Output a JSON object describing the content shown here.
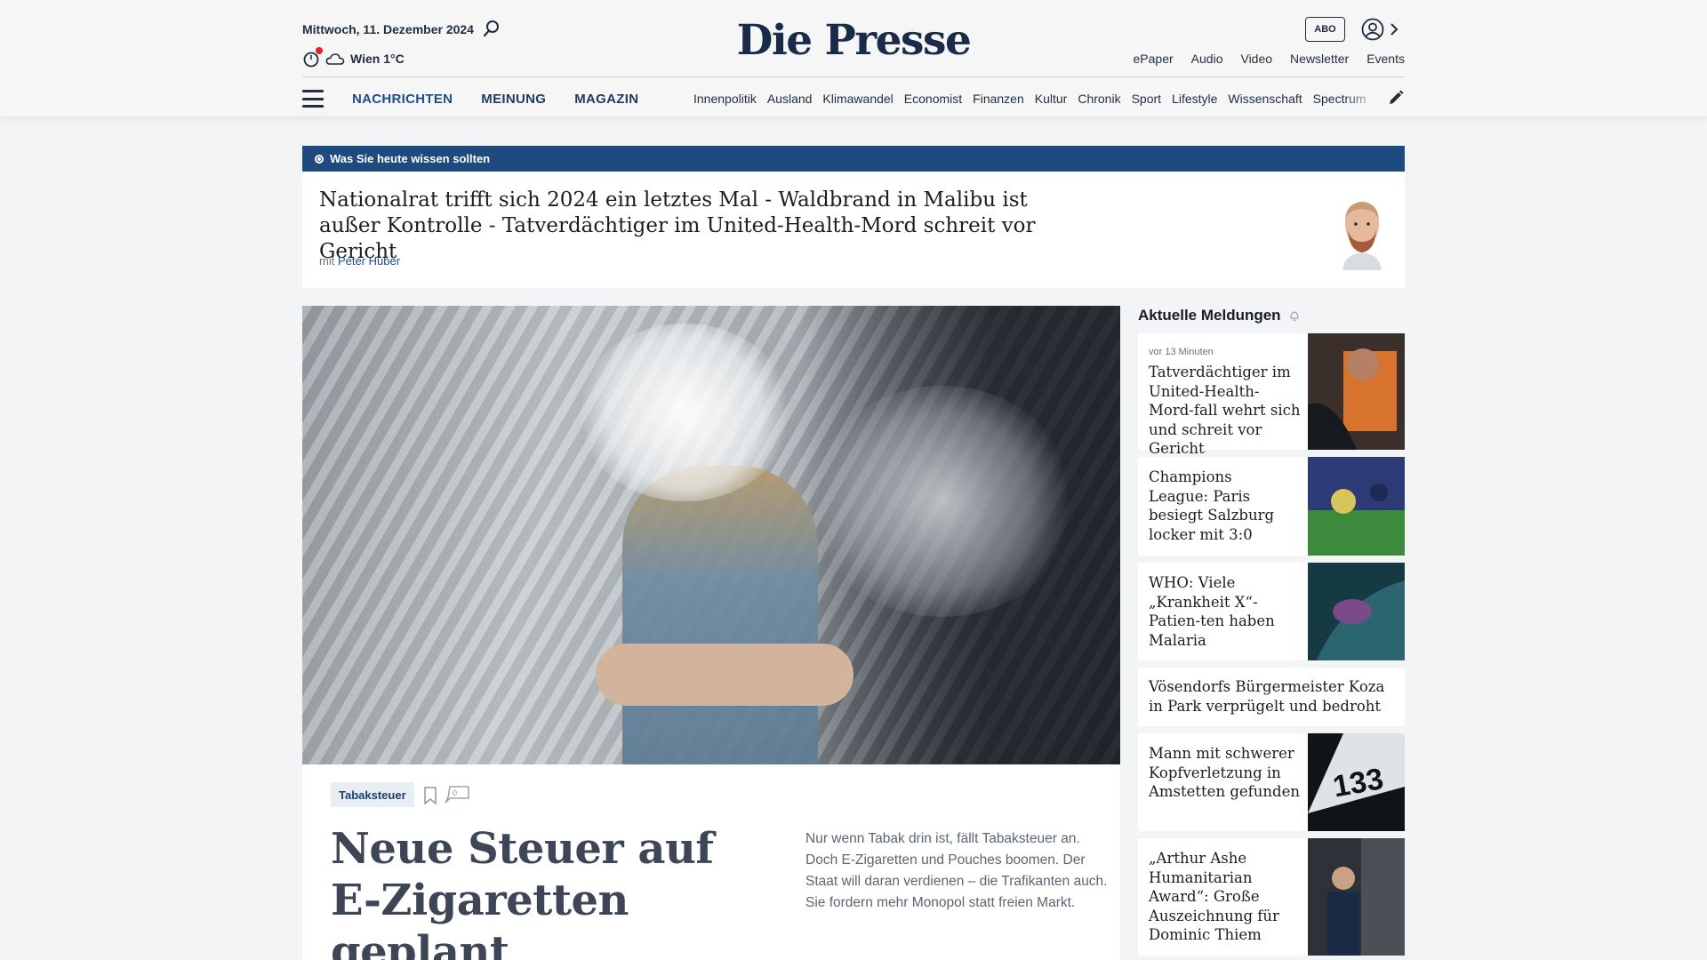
{
  "header": {
    "date": "Mittwoch, 11. Dezember 2024",
    "weather": "Wien 1°C",
    "logo": "Die Presse",
    "abo_label": "ABO",
    "links": [
      "ePaper",
      "Audio",
      "Video",
      "Newsletter",
      "Events"
    ]
  },
  "nav": {
    "main": [
      "NACHRICHTEN",
      "MEINUNG",
      "MAGAZIN"
    ],
    "sub": [
      "Innenpolitik",
      "Ausland",
      "Klimawandel",
      "Economist",
      "Finanzen",
      "Kultur",
      "Chronik",
      "Sport",
      "Lifestyle",
      "Wissenschaft",
      "Spectrum"
    ]
  },
  "briefing": {
    "label": "Was Sie heute wissen sollten",
    "title": "Nationalrat trifft sich 2024 ein letztes Mal - Waldbrand in Malibu ist außer Kontrolle - Tatverdächtiger im United-Health-Mord schreit vor Gericht",
    "byline_prefix": "mit",
    "author": "Peter Huber"
  },
  "lead": {
    "tag": "Tabaksteuer",
    "comment_count": "0",
    "title": "Neue Steuer auf E-Zigaretten geplant",
    "teaser": "Nur wenn Tabak drin ist, fällt Tabaksteuer an. Doch E-Zigaretten und Pouches boomen. Der Staat will daran verdienen – die Trafikanten auch. Sie fordern mehr Monopol statt freien Markt."
  },
  "sidebar": {
    "title": "Aktuelle Meldungen",
    "items": [
      {
        "time": "vor 13 Minuten",
        "title": "Tatverdächtiger im United-Health-Mord-fall wehrt sich und schreit vor Gericht"
      },
      {
        "title": "Champions League: Paris besiegt Salzburg locker mit 3:0"
      },
      {
        "title": "WHO: Viele „Krankheit X“-Patien-ten haben Malaria"
      },
      {
        "title": "Vösendorfs Bürgermeister Koza in Park verprügelt und bedroht"
      },
      {
        "title": "Mann mit schwerer Kopfverletzung in Amstetten gefunden"
      },
      {
        "title": "„Arthur Ashe Humanitarian Award“: Große Auszeichnung für Dominic Thiem"
      }
    ]
  },
  "colors": {
    "brand_navy": "#1a2b4a",
    "briefing_bar": "#1e4a7f",
    "link_blue": "#1c4e8a",
    "weather_alert": "#e0242b"
  },
  "icons": [
    "search-icon",
    "weather-alert-icon",
    "cloud-icon",
    "user-icon",
    "chevron-right-icon",
    "menu-icon",
    "pencil-icon",
    "live-dot-icon",
    "bookmark-icon",
    "comment-icon",
    "bell-icon"
  ]
}
